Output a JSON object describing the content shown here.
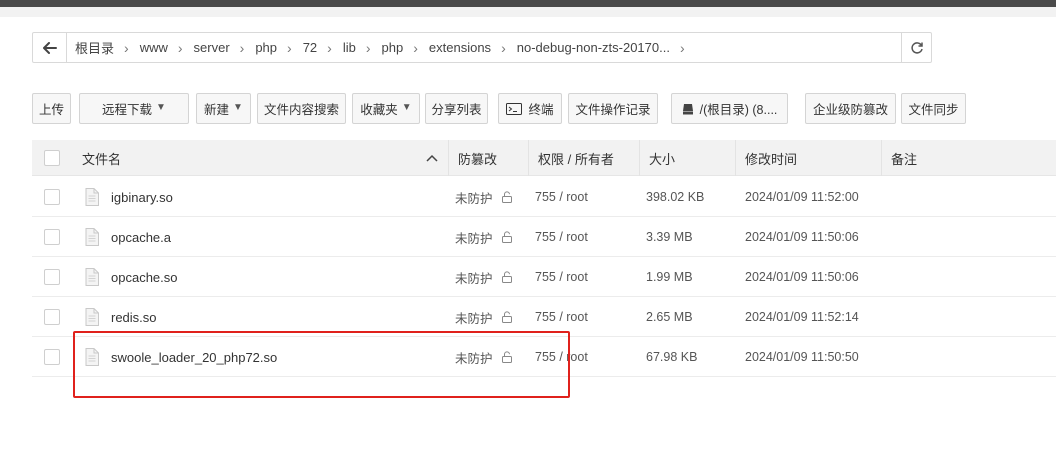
{
  "breadcrumb": {
    "items": [
      "根目录",
      "www",
      "server",
      "php",
      "72",
      "lib",
      "php",
      "extensions",
      "no-debug-non-zts-20170..."
    ]
  },
  "toolbar": {
    "upload": "上传",
    "remote_download": "远程下载",
    "new": "新建",
    "content_search": "文件内容搜索",
    "favorites": "收藏夹",
    "share_list": "分享列表",
    "terminal": "终端",
    "op_log": "文件操作记录",
    "disk": "/(根目录) (8....",
    "tamper_enterprise": "企业级防篡改",
    "file_sync": "文件同步"
  },
  "table": {
    "headers": {
      "name": "文件名",
      "tamper": "防篡改",
      "perm": "权限 / 所有者",
      "size": "大小",
      "mtime": "修改时间",
      "note": "备注"
    },
    "rows": [
      {
        "name": "igbinary.so",
        "tamper": "未防护",
        "perm": "755 / root",
        "size": "398.02 KB",
        "mtime": "2024/01/09 11:52:00"
      },
      {
        "name": "opcache.a",
        "tamper": "未防护",
        "perm": "755 / root",
        "size": "3.39 MB",
        "mtime": "2024/01/09 11:50:06"
      },
      {
        "name": "opcache.so",
        "tamper": "未防护",
        "perm": "755 / root",
        "size": "1.99 MB",
        "mtime": "2024/01/09 11:50:06"
      },
      {
        "name": "redis.so",
        "tamper": "未防护",
        "perm": "755 / root",
        "size": "2.65 MB",
        "mtime": "2024/01/09 11:52:14"
      },
      {
        "name": "swoole_loader_20_php72.so",
        "tamper": "未防护",
        "perm": "755 / root",
        "size": "67.98 KB",
        "mtime": "2024/01/09 11:50:50"
      }
    ]
  },
  "colors": {
    "highlight": "#e0211c",
    "header_bg": "#f2f2f2",
    "button_bg": "#f7f7f7"
  },
  "icons": {
    "back": "arrow-left-icon",
    "refresh": "refresh-icon",
    "terminal": "terminal-icon",
    "disk": "disk-icon",
    "file": "file-icon",
    "lock": "unlock-icon",
    "sort": "chevron-up-icon"
  }
}
